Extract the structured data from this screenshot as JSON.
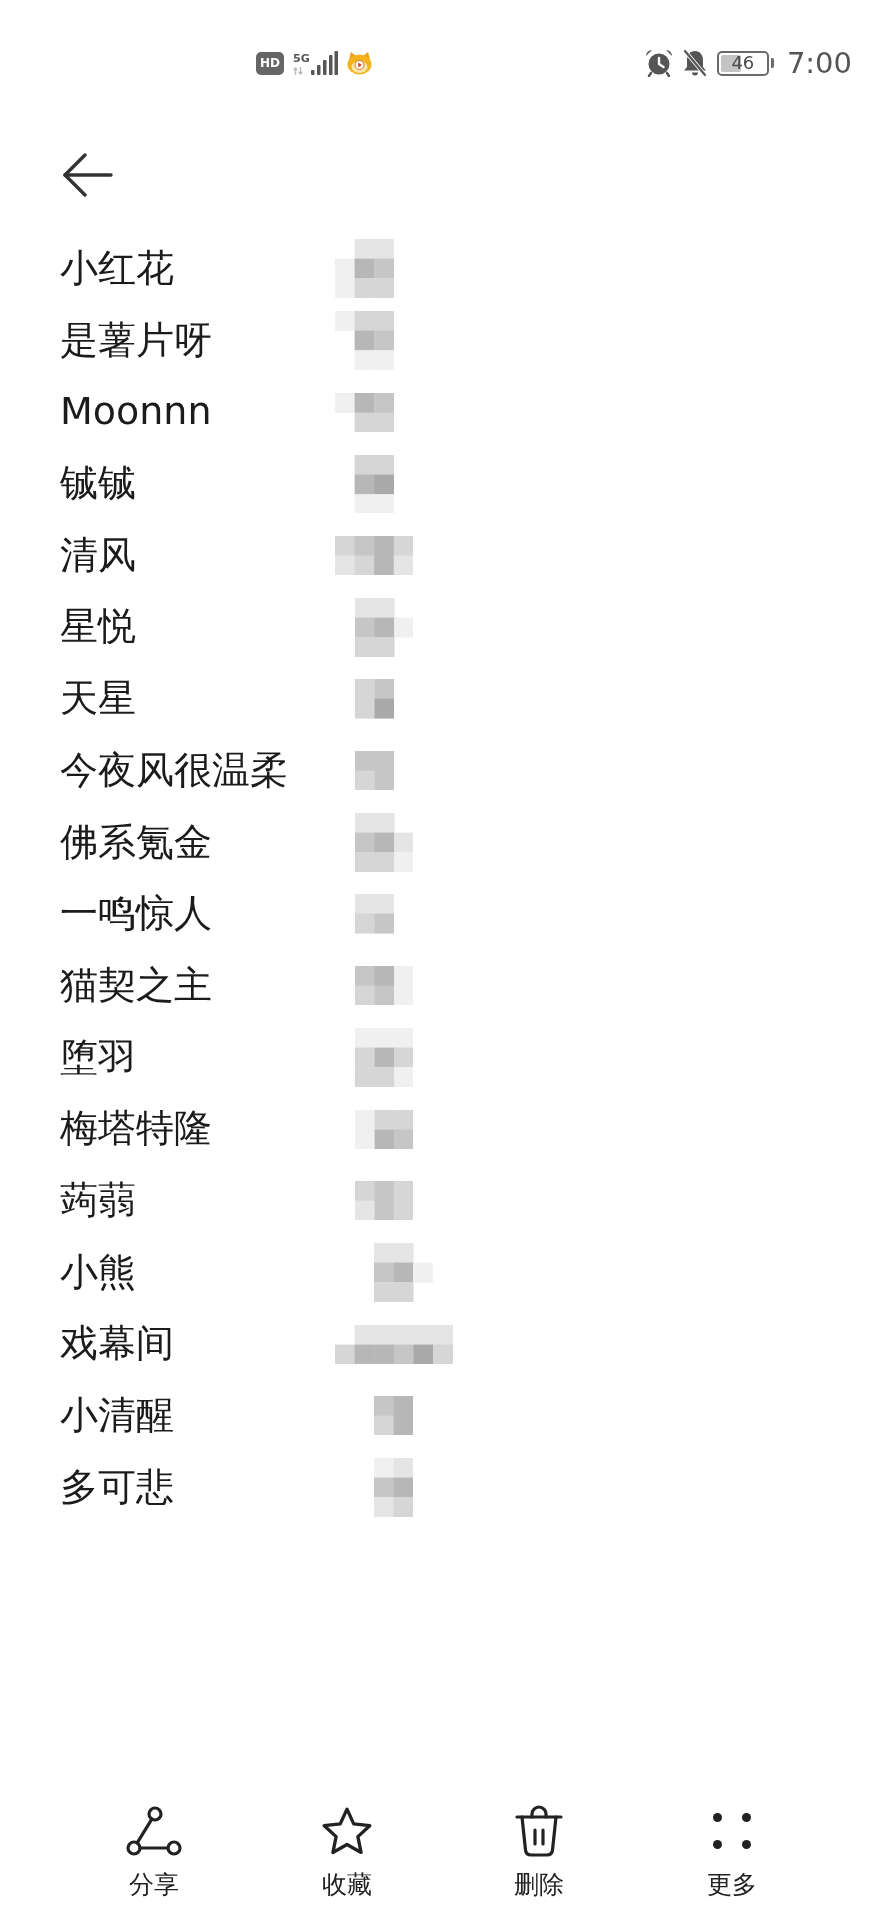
{
  "status_bar": {
    "hd_badge": "HD",
    "network_type": "5G",
    "battery_text": "46",
    "time": "7:00"
  },
  "contacts": [
    {
      "name": "小红花"
    },
    {
      "name": "是薯片呀"
    },
    {
      "name": "Moonnn"
    },
    {
      "name": "铖铖"
    },
    {
      "name": "清风"
    },
    {
      "name": "星悦"
    },
    {
      "name": "天星"
    },
    {
      "name": "今夜风很温柔"
    },
    {
      "name": "佛系氪金"
    },
    {
      "name": "一鸣惊人"
    },
    {
      "name": "猫契之主"
    },
    {
      "name": "堕羽"
    },
    {
      "name": "梅塔特隆"
    },
    {
      "name": "蒟蒻"
    },
    {
      "name": "小熊"
    },
    {
      "name": "戏幕间"
    },
    {
      "name": "小清醒"
    },
    {
      "name": "多可悲"
    }
  ],
  "bottom_actions": [
    {
      "kind": "share",
      "label": "分享"
    },
    {
      "kind": "favorite",
      "label": "收藏"
    },
    {
      "kind": "delete",
      "label": "删除"
    },
    {
      "kind": "more",
      "label": "更多"
    }
  ]
}
